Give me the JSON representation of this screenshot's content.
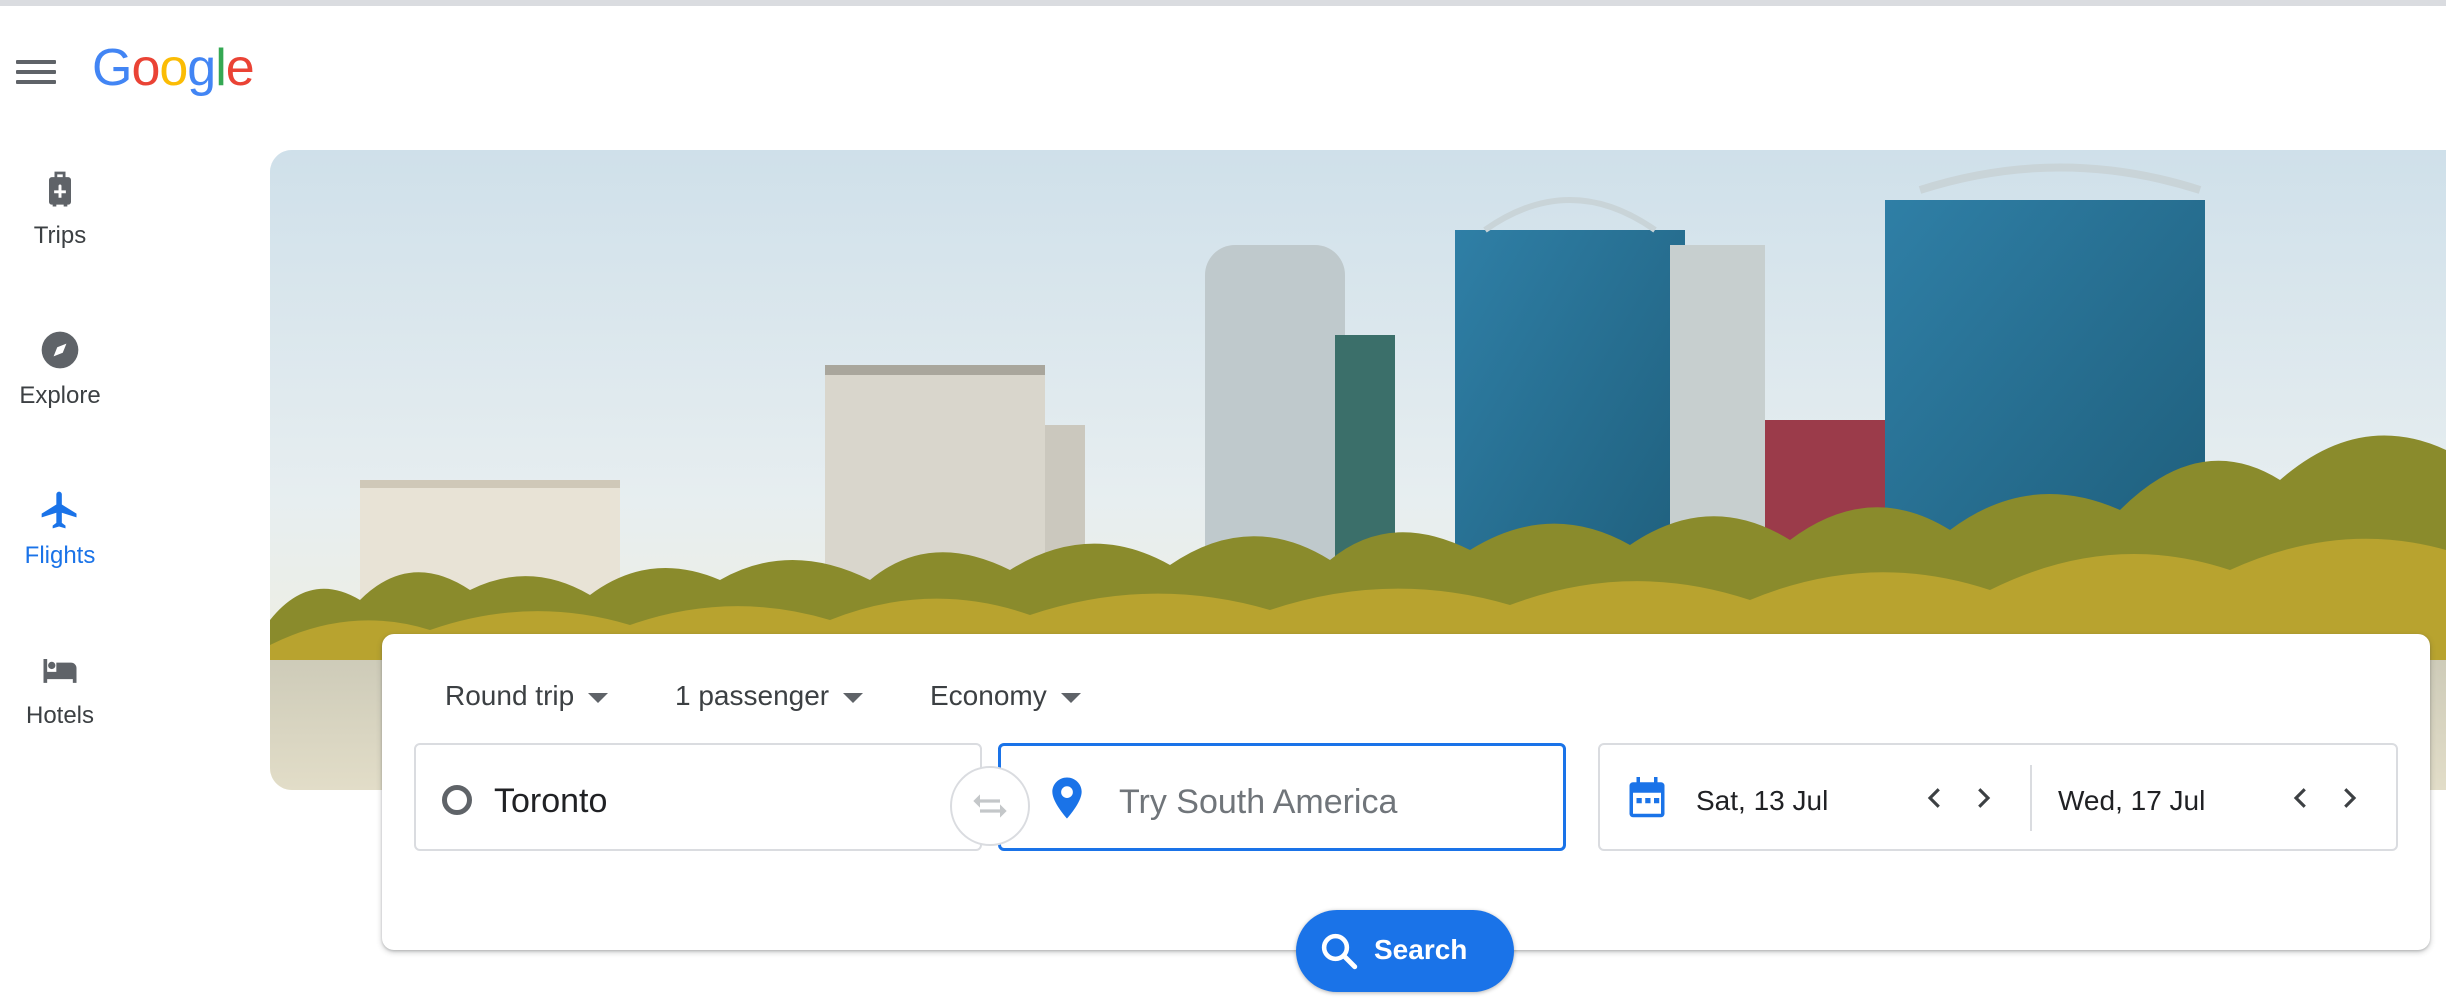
{
  "app": {
    "logo_text": "Google",
    "brand_colors": [
      "#4285f4",
      "#ea4335",
      "#fbbc05",
      "#34a853"
    ]
  },
  "sidebar": {
    "items": [
      {
        "label": "Trips",
        "icon": "luggage-icon",
        "active": false
      },
      {
        "label": "Explore",
        "icon": "compass-icon",
        "active": false
      },
      {
        "label": "Flights",
        "icon": "airplane-icon",
        "active": true
      },
      {
        "label": "Hotels",
        "icon": "bed-icon",
        "active": false
      }
    ]
  },
  "search_form": {
    "trip_type": "Round trip",
    "passengers": "1 passenger",
    "cabin_class": "Economy",
    "origin": "Toronto",
    "destination_placeholder": "Try South America",
    "departure_date": "Sat, 13 Jul",
    "return_date": "Wed, 17 Jul",
    "search_label": "Search"
  },
  "colors": {
    "accent": "#1a73e8",
    "text": "#3c4043",
    "border": "#dadce0"
  }
}
